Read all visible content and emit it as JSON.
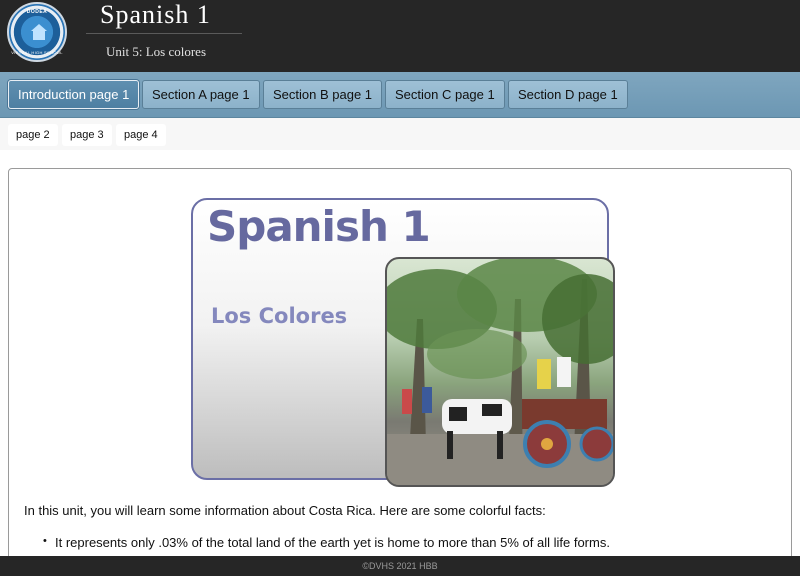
{
  "header": {
    "title": "Spanish 1",
    "subtitle": "Unit 5: Los colores",
    "logo": {
      "top_text": "DODEA",
      "side_text": "VIRTUAL HIGH SCHOOL",
      "icon": "school-house-icon"
    }
  },
  "nav": {
    "tabs": [
      {
        "label": "Introduction page 1",
        "active": true
      },
      {
        "label": "Section A page 1",
        "active": false
      },
      {
        "label": "Section B page 1",
        "active": false
      },
      {
        "label": "Section C page 1",
        "active": false
      },
      {
        "label": "Section D page 1",
        "active": false
      }
    ],
    "subtabs": [
      {
        "label": "page 2"
      },
      {
        "label": "page 3"
      },
      {
        "label": "page 4"
      }
    ]
  },
  "banner": {
    "title": "Spanish 1",
    "subtitle": "Los Colores",
    "photo": "costa-rica-oxcart-photo"
  },
  "content": {
    "intro": "In this unit, you will learn some information about Costa Rica. Here are some colorful facts:",
    "bullets": [
      "It represents only .03% of the total land of the earth yet is home to more than 5% of all life forms."
    ]
  },
  "footer": {
    "text": "©DVHS 2021 HBB"
  },
  "colors": {
    "header_bg": "#262626",
    "nav_bg": "#7fa6bf",
    "active_tab": "#5f8fb0",
    "banner_text": "#66699f"
  }
}
